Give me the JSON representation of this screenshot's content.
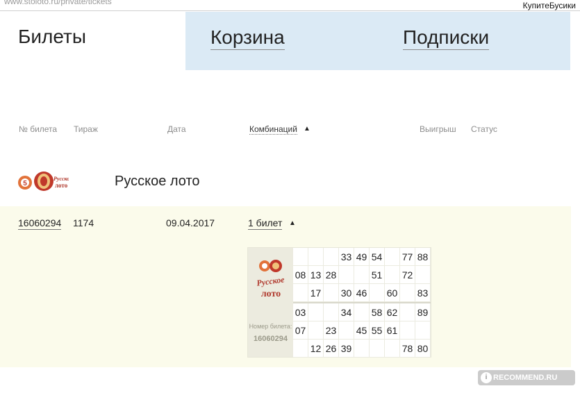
{
  "browser": {
    "url": "www.stoloto.ru/private/tickets",
    "user_badge": "КупитеБусики"
  },
  "tabs": [
    {
      "label": "Билеты",
      "active": true
    },
    {
      "label": "Корзина",
      "active": false
    },
    {
      "label": "Подписки",
      "active": false
    }
  ],
  "columns": {
    "ticket_no": "№ билета",
    "draw": "Тираж",
    "date": "Дата",
    "combinations": "Комбинаций",
    "sort_icon": "triangle-up-icon",
    "winnings": "Выигрыш",
    "status": "Статус"
  },
  "game": {
    "logo_text_1": "Русское",
    "logo_text_2": "лото",
    "title": "Русское лото"
  },
  "ticket": {
    "number": "16060294",
    "draw": "1174",
    "date": "09.04.2017",
    "combinations": "1 билет",
    "card_number_label": "Номер билета:",
    "card_number": "16060294",
    "field_1": [
      [
        "",
        "",
        "",
        "33",
        "49",
        "54",
        "",
        "77",
        "88"
      ],
      [
        "08",
        "13",
        "28",
        "",
        "",
        "51",
        "",
        "72",
        ""
      ],
      [
        "",
        "17",
        "",
        "30",
        "46",
        "",
        "60",
        "",
        "83"
      ]
    ],
    "field_2": [
      [
        "03",
        "",
        "",
        "34",
        "",
        "58",
        "62",
        "",
        "89"
      ],
      [
        "07",
        "",
        "23",
        "",
        "45",
        "55",
        "61",
        "",
        ""
      ],
      [
        "",
        "12",
        "26",
        "39",
        "",
        "",
        "",
        "78",
        "80"
      ]
    ]
  },
  "watermark": "RECOMMEND.RU",
  "colors": {
    "tab_inactive": "#dbeaf5",
    "row_bg": "#fbfbeb",
    "logo_red": "#c0392b",
    "logo_orange": "#e67e22"
  }
}
